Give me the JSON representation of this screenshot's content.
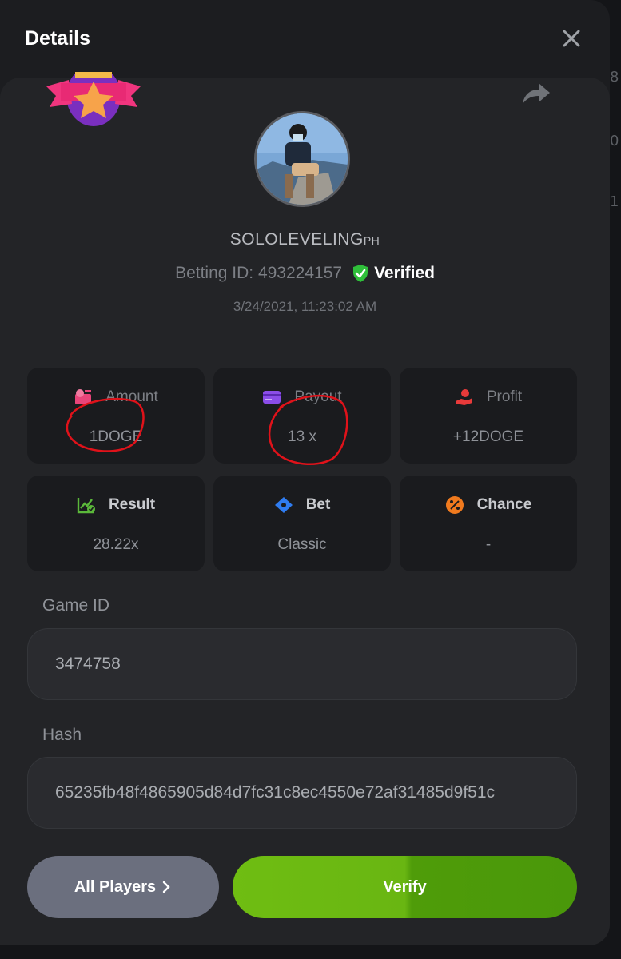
{
  "header": {
    "title": "Details"
  },
  "profile": {
    "username": "SOLOLEVELING",
    "username_suffix": "PH",
    "betting_id_label": "Betting ID: 493224157",
    "verified_label": "Verified",
    "timestamp": "3/24/2021, 11:23:02 AM"
  },
  "stats": [
    {
      "label": "Amount",
      "value": "1DOGE",
      "icon": "money-icon",
      "color": "#e8457a"
    },
    {
      "label": "Payout",
      "value": "13 x",
      "icon": "card-icon",
      "color": "#8b4de8"
    },
    {
      "label": "Profit",
      "value": "+12DOGE",
      "icon": "hand-coin-icon",
      "color": "#e83a3a"
    },
    {
      "label": "Result",
      "value": "28.22x",
      "icon": "chart-check-icon",
      "color": "#5bb83a"
    },
    {
      "label": "Bet",
      "value": "Classic",
      "icon": "ticket-icon",
      "color": "#2f7cf0"
    },
    {
      "label": "Chance",
      "value": "-",
      "icon": "percent-icon",
      "color": "#f07a1e"
    }
  ],
  "game": {
    "label": "Game ID",
    "value": "3474758"
  },
  "hash": {
    "label": "Hash",
    "value": "65235fb48f4865905d84d7fc31c8ec4550e72af31485d9f51c"
  },
  "buttons": {
    "all_players": "All Players",
    "verify": "Verify"
  },
  "background_edge": [
    "8",
    "0",
    "1"
  ]
}
